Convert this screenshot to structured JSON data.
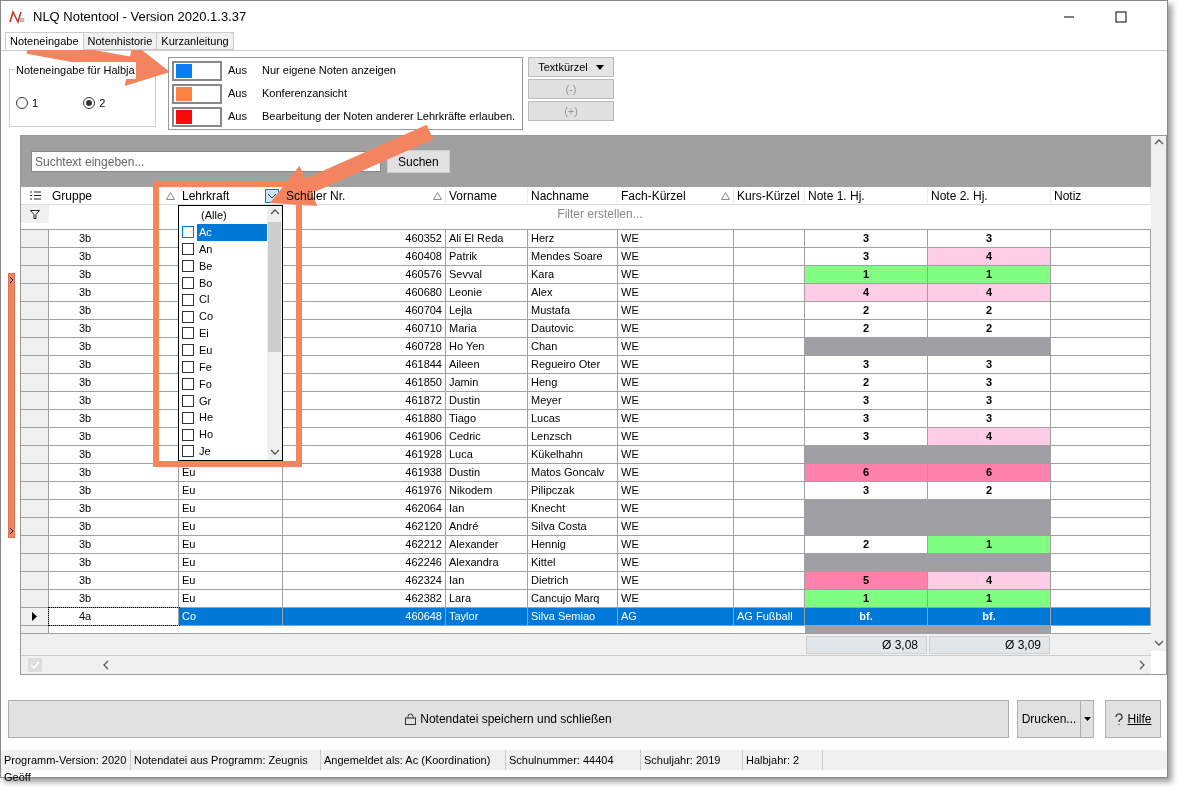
{
  "window": {
    "title": "NLQ Notentool - Version 2020.1.3.37"
  },
  "tabs": [
    {
      "label": "Noteneingabe",
      "selected": true
    },
    {
      "label": "Notenhistorie",
      "selected": false
    },
    {
      "label": "Kurzanleitung",
      "selected": false
    }
  ],
  "halbjahr": {
    "label": "Noteneingabe für Halbja",
    "options": [
      {
        "label": "1",
        "selected": false
      },
      {
        "label": "2",
        "selected": true
      }
    ]
  },
  "toggles": [
    {
      "color": "#0a7cf5",
      "on": false,
      "state": "Aus",
      "label": "Nur eigene Noten anzeigen"
    },
    {
      "color": "#fb8240",
      "on": false,
      "state": "Aus",
      "label": "Konferenzansicht"
    },
    {
      "color": "#f80a0a",
      "on": false,
      "state": "Aus",
      "label": "Bearbeitung der Noten anderer Lehrkräfte erlauben."
    }
  ],
  "side_buttons": [
    {
      "label": "Textkürzel",
      "disabled": false,
      "kind": "menu"
    },
    {
      "label": "(-)",
      "disabled": true,
      "kind": "plain"
    },
    {
      "label": "(+)",
      "disabled": true,
      "kind": "plain"
    }
  ],
  "search": {
    "placeholder": "Suchtext eingeben...",
    "button": "Suchen"
  },
  "table": {
    "columns": [
      {
        "label": "Gruppe",
        "kind": "sort"
      },
      {
        "label": "Lehrkraft",
        "kind": "filter"
      },
      {
        "label": "Schüler Nr.",
        "kind": "sort"
      },
      {
        "label": "Vorname",
        "kind": "plain"
      },
      {
        "label": "Nachname",
        "kind": "plain"
      },
      {
        "label": "Fach-Kürzel",
        "kind": "sort"
      },
      {
        "label": "Kurs-Kürzel",
        "kind": "plain"
      },
      {
        "label": "Note 1. Hj.",
        "kind": "plain"
      },
      {
        "label": "Note 2. Hj.",
        "kind": "plain"
      },
      {
        "label": "Notiz",
        "kind": "plain"
      }
    ],
    "filter_placeholder": "Filter erstellen...",
    "rows": [
      {
        "selected": false,
        "gruppe": "3b",
        "nr": "460352",
        "vorname": "Ali El Reda",
        "nachname": "Herz",
        "fach": "WE",
        "note1": {
          "text": "3",
          "color": "#ffffff"
        },
        "note2": {
          "text": "3",
          "color": "#ffffff"
        }
      },
      {
        "selected": false,
        "gruppe": "3b",
        "nr": "460408",
        "vorname": "Patrik",
        "nachname": "Mendes Soare",
        "fach": "WE",
        "note1": {
          "text": "3",
          "color": "#ffffff"
        },
        "note2": {
          "text": "4",
          "color": "#ffcce6"
        }
      },
      {
        "selected": false,
        "gruppe": "3b",
        "nr": "460576",
        "vorname": "Sevval",
        "nachname": "Kara",
        "fach": "WE",
        "note1": {
          "text": "1",
          "color": "#80ff80"
        },
        "note2": {
          "text": "1",
          "color": "#80ff80"
        }
      },
      {
        "selected": false,
        "gruppe": "3b",
        "nr": "460680",
        "vorname": "Leonie",
        "nachname": "Alex",
        "fach": "WE",
        "note1": {
          "text": "4",
          "color": "#ffcce6"
        },
        "note2": {
          "text": "4",
          "color": "#ffcce6"
        }
      },
      {
        "selected": false,
        "gruppe": "3b",
        "nr": "460704",
        "vorname": "Lejla",
        "nachname": "Mustafa",
        "fach": "WE",
        "note1": {
          "text": "2",
          "color": "#ffffff"
        },
        "note2": {
          "text": "2",
          "color": "#ffffff"
        }
      },
      {
        "selected": false,
        "gruppe": "3b",
        "nr": "460710",
        "vorname": "Maria",
        "nachname": "Dautovic",
        "fach": "WE",
        "note1": {
          "text": "2",
          "color": "#ffffff"
        },
        "note2": {
          "text": "2",
          "color": "#ffffff"
        }
      },
      {
        "selected": false,
        "gruppe": "3b",
        "nr": "460728",
        "vorname": "Ho Yen",
        "nachname": "Chan",
        "fach": "WE",
        "note1": {
          "color": "#a0a0a4"
        },
        "note2": {
          "color": "#a0a0a4"
        }
      },
      {
        "selected": false,
        "gruppe": "3b",
        "nr": "461844",
        "vorname": "Aileen",
        "nachname": "Regueiro Oter",
        "fach": "WE",
        "note1": {
          "text": "3",
          "color": "#ffffff"
        },
        "note2": {
          "text": "3",
          "color": "#ffffff"
        }
      },
      {
        "selected": false,
        "gruppe": "3b",
        "nr": "461850",
        "vorname": "Jamin",
        "nachname": "Heng",
        "fach": "WE",
        "note1": {
          "text": "2",
          "color": "#ffffff"
        },
        "note2": {
          "text": "3",
          "color": "#ffffff"
        }
      },
      {
        "selected": false,
        "gruppe": "3b",
        "nr": "461872",
        "vorname": "Dustin",
        "nachname": "Meyer",
        "fach": "WE",
        "note1": {
          "text": "3",
          "color": "#ffffff"
        },
        "note2": {
          "text": "3",
          "color": "#ffffff"
        }
      },
      {
        "selected": false,
        "gruppe": "3b",
        "nr": "461880",
        "vorname": "Tiago",
        "nachname": "Lucas",
        "fach": "WE",
        "note1": {
          "text": "3",
          "color": "#ffffff"
        },
        "note2": {
          "text": "3",
          "color": "#ffffff"
        }
      },
      {
        "selected": false,
        "gruppe": "3b",
        "nr": "461906",
        "vorname": "Cedric",
        "nachname": "Lenzsch",
        "fach": "WE",
        "note1": {
          "text": "3",
          "color": "#ffffff"
        },
        "note2": {
          "text": "4",
          "color": "#ffcce6"
        }
      },
      {
        "selected": false,
        "gruppe": "3b",
        "nr": "461928",
        "vorname": "Luca",
        "nachname": "Kükelhahn",
        "fach": "WE",
        "note1": {
          "color": "#a0a0a4"
        },
        "note2": {
          "color": "#a0a0a4"
        }
      },
      {
        "selected": false,
        "gruppe": "3b",
        "lehrkraft": "Eu",
        "nr": "461938",
        "vorname": "Dustin",
        "nachname": "Matos Goncalv",
        "fach": "WE",
        "note1": {
          "text": "6",
          "color": "#ff80aa"
        },
        "note2": {
          "text": "6",
          "color": "#ff80aa"
        }
      },
      {
        "selected": false,
        "gruppe": "3b",
        "lehrkraft": "Eu",
        "nr": "461976",
        "vorname": "Nikodem",
        "nachname": "Pilipczak",
        "fach": "WE",
        "note1": {
          "text": "3",
          "color": "#ffffff"
        },
        "note2": {
          "text": "2",
          "color": "#ffffff"
        }
      },
      {
        "selected": false,
        "gruppe": "3b",
        "lehrkraft": "Eu",
        "nr": "462064",
        "vorname": "Ian",
        "nachname": "Knecht",
        "fach": "WE",
        "note1": {
          "color": "#a0a0a4"
        },
        "note2": {
          "color": "#a0a0a4"
        }
      },
      {
        "selected": false,
        "gruppe": "3b",
        "lehrkraft": "Eu",
        "nr": "462120",
        "vorname": "André",
        "nachname": "Silva Costa",
        "fach": "WE",
        "note1": {
          "color": "#a0a0a4"
        },
        "note2": {
          "color": "#a0a0a4"
        }
      },
      {
        "selected": false,
        "gruppe": "3b",
        "lehrkraft": "Eu",
        "nr": "462212",
        "vorname": "Alexander",
        "nachname": "Hennig",
        "fach": "WE",
        "note1": {
          "text": "2",
          "color": "#ffffff"
        },
        "note2": {
          "text": "1",
          "color": "#80ff80"
        }
      },
      {
        "selected": false,
        "gruppe": "3b",
        "lehrkraft": "Eu",
        "nr": "462246",
        "vorname": "Alexandra",
        "nachname": "Kittel",
        "fach": "WE",
        "note1": {
          "color": "#a0a0a4"
        },
        "note2": {
          "color": "#a0a0a4"
        }
      },
      {
        "selected": false,
        "gruppe": "3b",
        "lehrkraft": "Eu",
        "nr": "462324",
        "vorname": "Ian",
        "nachname": "Dietrich",
        "fach": "WE",
        "note1": {
          "text": "5",
          "color": "#ff80aa"
        },
        "note2": {
          "text": "4",
          "color": "#ffcce6"
        }
      },
      {
        "selected": false,
        "gruppe": "3b",
        "lehrkraft": "Eu",
        "nr": "462382",
        "vorname": "Lara",
        "nachname": "Cancujo Marq",
        "fach": "WE",
        "note1": {
          "text": "1",
          "color": "#80ff80"
        },
        "note2": {
          "text": "1",
          "color": "#80ff80"
        }
      },
      {
        "selected": true,
        "gruppe": "4a",
        "lehrkraft": "Co",
        "nr": "460648",
        "vorname": "Taylor",
        "nachname": "Silva Semiao",
        "fach": "AG",
        "kurs": "AG Fußball",
        "note1": {
          "text": "bf.",
          "color": "#0078d7"
        },
        "note2": {
          "text": "bf.",
          "color": "#0078d7"
        }
      }
    ],
    "averages": [
      "Ø 3,08",
      "Ø 3,09"
    ]
  },
  "filter_dropdown": {
    "items": [
      {
        "label": "(Alle)",
        "kind": "all",
        "selected": false
      },
      {
        "label": "Ac",
        "kind": "option",
        "checked": false,
        "selected": true
      },
      {
        "label": "An",
        "kind": "option",
        "checked": false,
        "selected": false
      },
      {
        "label": "Be",
        "kind": "option",
        "checked": false,
        "selected": false
      },
      {
        "label": "Bo",
        "kind": "option",
        "checked": false,
        "selected": false
      },
      {
        "label": "Cl",
        "kind": "option",
        "checked": false,
        "selected": false
      },
      {
        "label": "Co",
        "kind": "option",
        "checked": false,
        "selected": false
      },
      {
        "label": "Ei",
        "kind": "option",
        "checked": false,
        "selected": false
      },
      {
        "label": "Eu",
        "kind": "option",
        "checked": false,
        "selected": false
      },
      {
        "label": "Fe",
        "kind": "option",
        "checked": false,
        "selected": false
      },
      {
        "label": "Fo",
        "kind": "option",
        "checked": false,
        "selected": false
      },
      {
        "label": "Gr",
        "kind": "option",
        "checked": false,
        "selected": false
      },
      {
        "label": "He",
        "kind": "option",
        "checked": false,
        "selected": false
      },
      {
        "label": "Ho",
        "kind": "option",
        "checked": false,
        "selected": false
      },
      {
        "label": "Je",
        "kind": "option",
        "checked": false,
        "selected": false
      }
    ]
  },
  "actions": {
    "save": "Notendatei speichern und schließen",
    "print": "Drucken...",
    "help": "Hilfe"
  },
  "status_bar": [
    "Programm-Version: 2020",
    "Notendatei aus Programm: Zeugnis",
    "Angemeldet als: Ac (Koordination)",
    "Schulnummer: 44404",
    "Schuljahr: 2019",
    "Halbjahr: 2"
  ],
  "status_line": "Geöff"
}
